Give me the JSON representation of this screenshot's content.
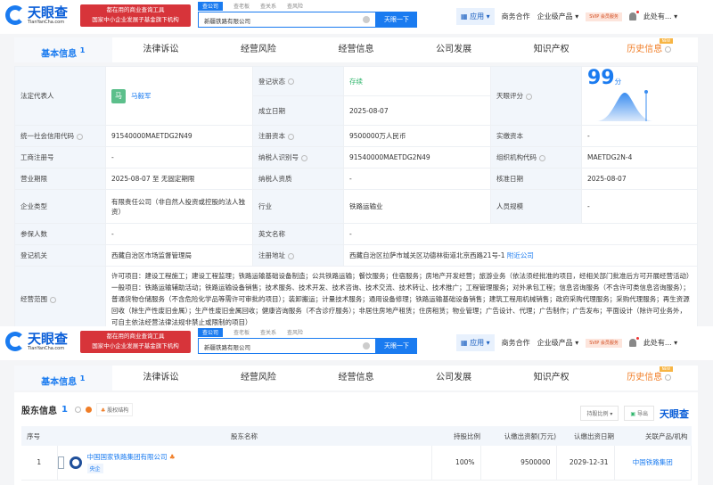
{
  "header": {
    "logo": "天眼查",
    "logo_sub": "TianYanCha.com",
    "slogan_1": "都在用的商业查询工具",
    "slogan_2": "国家中小企业发展子基金旗下机构",
    "search_tabs": [
      "查公司",
      "查老板",
      "查关系",
      "查风险"
    ],
    "search_value": "新疆铁路有限公司",
    "search_button": "天眼一下",
    "nav": {
      "app": "应用",
      "business": "商务合作",
      "enterprise": "企业级产品",
      "vip": "SVIP 会员服务",
      "user": "此处有..."
    }
  },
  "tabs": [
    {
      "label": "基本信息",
      "count": "1"
    },
    {
      "label": "法律诉讼"
    },
    {
      "label": "经营风险"
    },
    {
      "label": "经营信息"
    },
    {
      "label": "公司发展"
    },
    {
      "label": "知识产权"
    },
    {
      "label": "历史信息",
      "badge": "NEW"
    }
  ],
  "info": {
    "legal_rep_label": "法定代表人",
    "legal_rep_avatar": "马",
    "legal_rep": "马毅军",
    "status_label": "登记状态",
    "status": "存续",
    "founded_label": "成立日期",
    "founded": "2025-08-07",
    "score_label": "天眼评分",
    "score": "99",
    "score_unit": "分",
    "credit_code_label": "统一社会信用代码",
    "credit_code": "91540000MAETDG2N49",
    "reg_capital_label": "注册资本",
    "reg_capital": "9500000万人民币",
    "paid_capital_label": "实缴资本",
    "paid_capital": "-",
    "reg_no_label": "工商注册号",
    "reg_no": "-",
    "taxpayer_id_label": "纳税人识别号",
    "taxpayer_id": "91540000MAETDG2N49",
    "org_code_label": "组织机构代码",
    "org_code": "MAETDG2N-4",
    "term_label": "营业期限",
    "term": "2025-08-07 至 无固定期限",
    "tax_qual_label": "纳税人资质",
    "tax_qual": "-",
    "approved_label": "核准日期",
    "approved": "2025-08-07",
    "type_label": "企业类型",
    "type": "有限责任公司（非自然人投资或控股的法人独资）",
    "industry_label": "行业",
    "industry": "铁路运输业",
    "staff_label": "人员规模",
    "staff": "-",
    "insured_label": "参保人数",
    "insured": "-",
    "en_name_label": "英文名称",
    "en_name": "-",
    "authority_label": "登记机关",
    "authority": "西藏自治区市场监督管理局",
    "address_label": "注册地址",
    "address": "西藏自治区拉萨市城关区功德林街道北京西路21号-1",
    "nearby": "附近公司",
    "scope_label": "经营范围",
    "scope": "许可项目：建设工程施工；建设工程监理；铁路运输基础设备制造；公共铁路运输；餐饮服务；住宿服务；房地产开发经营；旅游业务（依法须经批准的项目，经相关部门批准后方可开展经营活动）一般项目：铁路运输辅助活动；铁路运输设备销售；技术服务、技术开发、技术咨询、技术交流、技术转让、技术推广；工程管理服务；对外承包工程；信息咨询服务（不含许可类信息咨询服务）；普通货物仓储服务（不含危险化学品等需许可审批的项目）；装卸搬运；计量技术服务；通用设备修理；铁路运输基础设备销售；建筑工程用机械销售；政府采购代理服务；采购代理服务；再生资源回收（除生产性废旧金属）；生产性废旧金属回收；健康咨询服务（不含诊疗服务）；非居住房地产租赁；住房租赁；物业管理；广告设计、代理；广告制作；广告发布；平面设计（除许可业务外，可自主依法经营法律法规非禁止或限制的项目）"
  },
  "shareholders": {
    "title": "股东信息",
    "count": "1",
    "equity_button": "股权结构",
    "ratio_filter": "持股比例",
    "export": "导出",
    "logo": "天眼查",
    "columns": [
      "序号",
      "股东名称",
      "持股比例",
      "认缴出资额(万元)",
      "认缴出资日期",
      "关联产品/机构"
    ],
    "rows": [
      {
        "no": "1",
        "name": "中国国家铁路集团有限公司",
        "tag": "央企",
        "ratio": "100%",
        "amount": "9500000",
        "date": "2029-12-31",
        "related": "中国铁路集团"
      }
    ]
  }
}
